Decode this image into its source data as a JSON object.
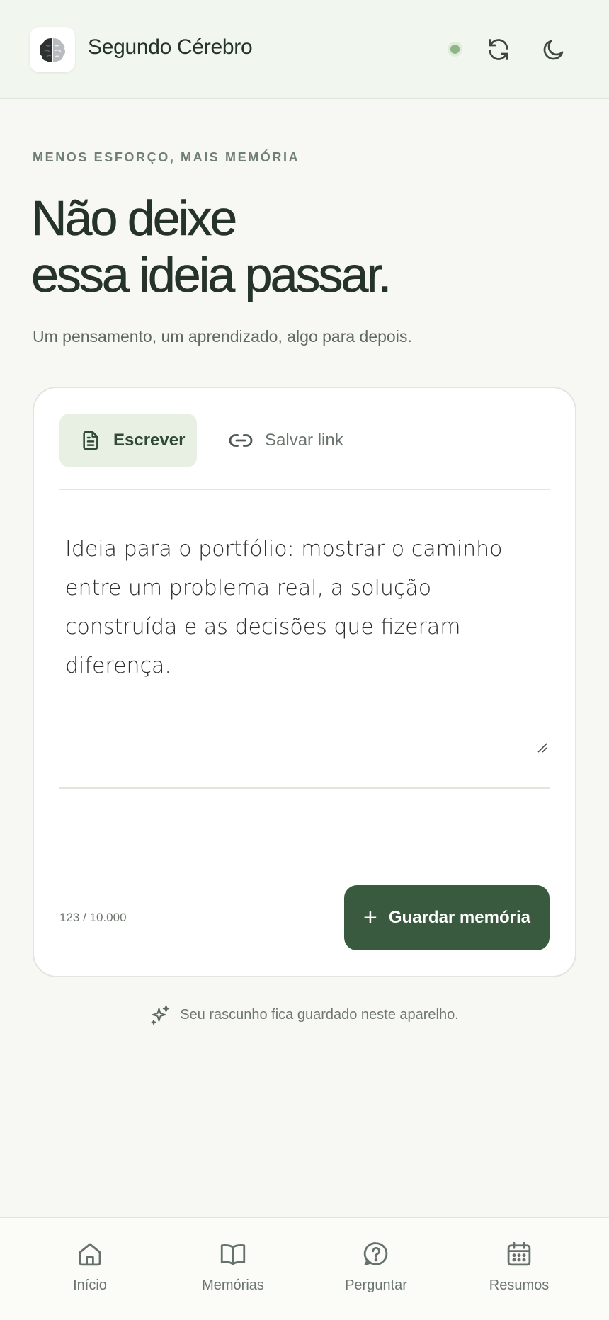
{
  "header": {
    "app_title": "Segundo Cérebro",
    "logo_icon": "brain-icon",
    "status": "online",
    "status_color": "#8fb487",
    "sync_icon": "refresh-icon",
    "theme_icon": "moon-icon"
  },
  "hero": {
    "eyebrow": "MENOS ESFORÇO, MAIS MEMÓRIA",
    "headline_line1": "Não deixe",
    "headline_line2": "essa ideia passar.",
    "subtitle": "Um pensamento, um aprendizado, algo para depois."
  },
  "composer": {
    "tabs": [
      {
        "label": "Escrever",
        "icon": "document-icon",
        "active": true
      },
      {
        "label": "Salvar link",
        "icon": "link-icon",
        "active": false
      }
    ],
    "text_value": "Ideia para o portfólio: mostrar o caminho entre um problema real, a solução construída e as decisões que fizeram diferença.",
    "char_count": "123 / 10.000",
    "save_button_label": "Guardar memória",
    "save_button_icon": "plus-icon",
    "accent_color": "#3a5a40"
  },
  "draft_note": {
    "icon": "sparkles-icon",
    "text": "Seu rascunho fica guardado neste aparelho."
  },
  "bottom_nav": {
    "items": [
      {
        "label": "Início",
        "icon": "home-icon"
      },
      {
        "label": "Memórias",
        "icon": "book-icon"
      },
      {
        "label": "Perguntar",
        "icon": "question-icon"
      },
      {
        "label": "Resumos",
        "icon": "calendar-icon"
      }
    ]
  }
}
